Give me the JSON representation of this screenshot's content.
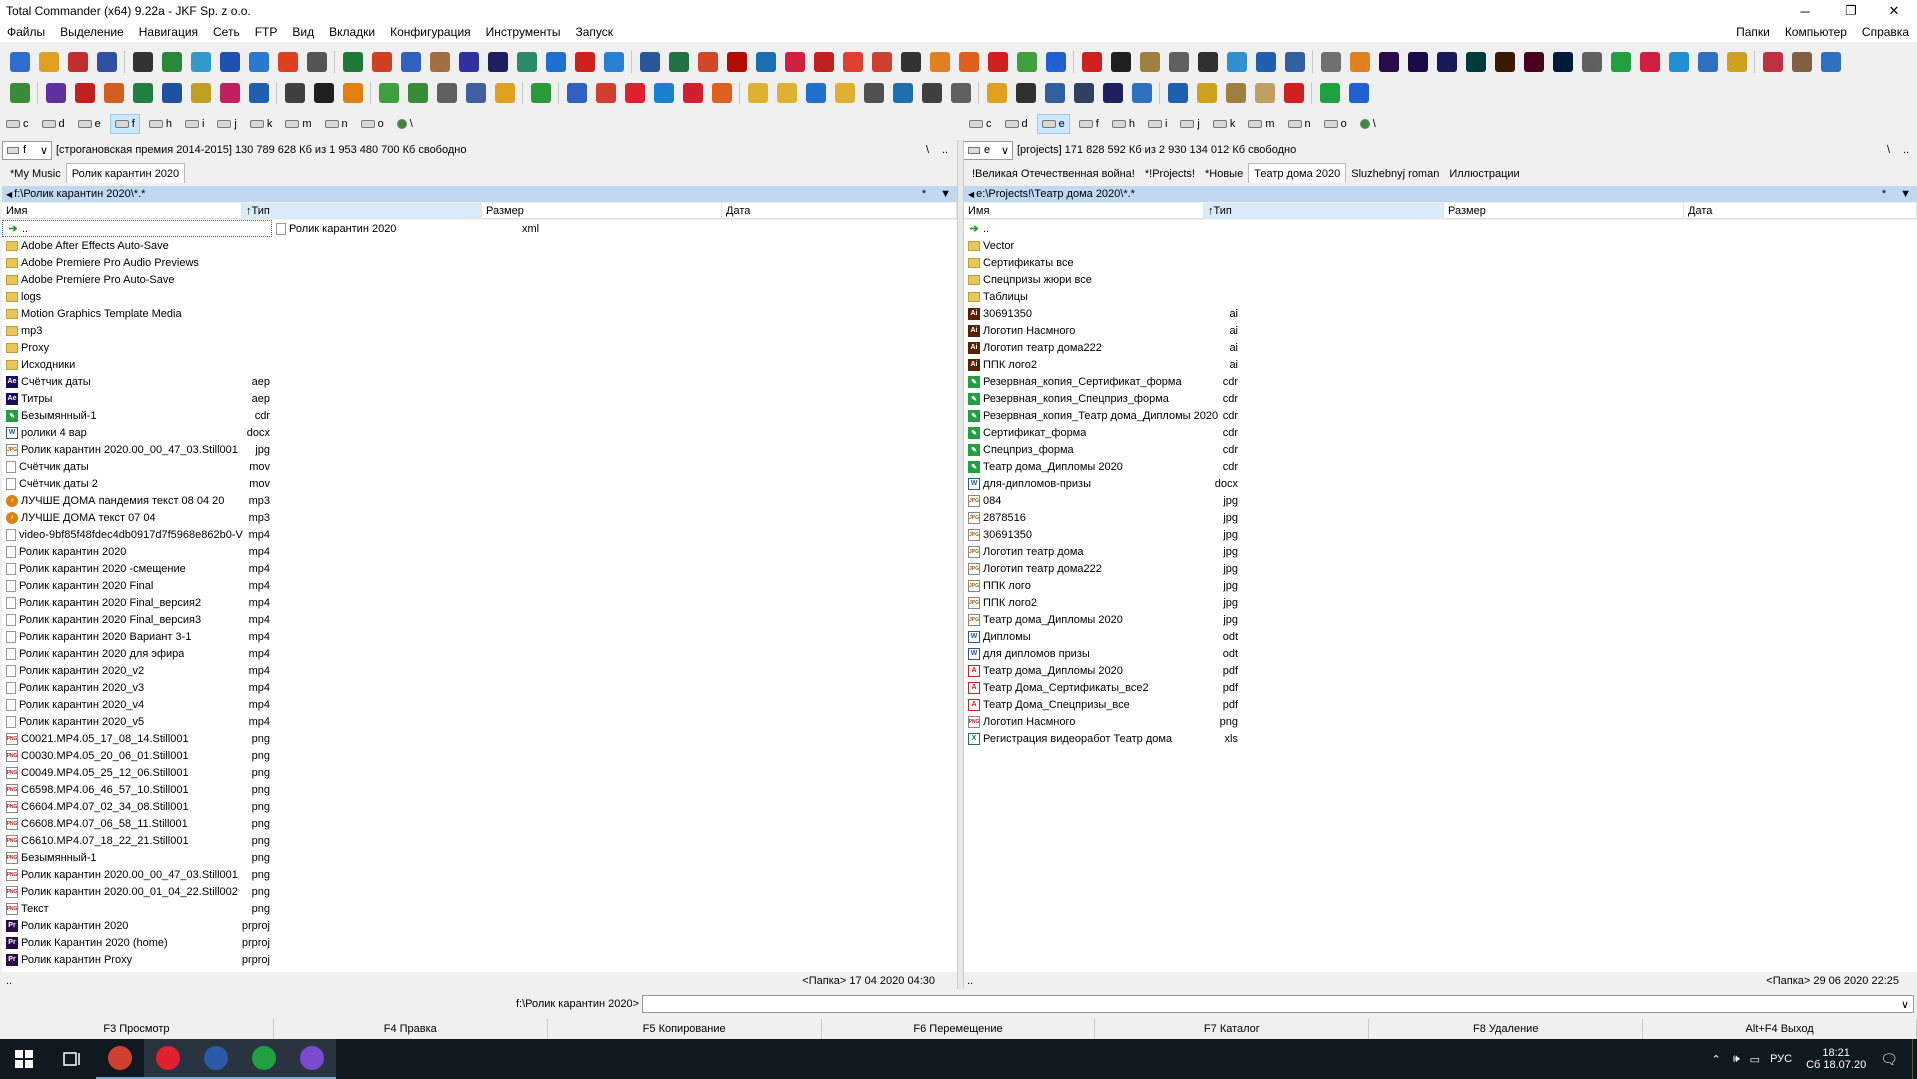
{
  "window": {
    "title": "Total Commander (x64) 9.22a - JKF Sp. z o.o."
  },
  "menu": {
    "left": [
      "Файлы",
      "Выделение",
      "Навигация",
      "Сеть",
      "FTP",
      "Вид",
      "Вкладки",
      "Конфигурация",
      "Инструменты",
      "Запуск"
    ],
    "right": [
      "Папки",
      "Компьютер",
      "Справка"
    ]
  },
  "toolbar_icons": {
    "row1": [
      {
        "name": "settings-gear-icon",
        "color": "#2d6fd1"
      },
      {
        "name": "settings-sun-icon",
        "color": "#e0a020"
      },
      {
        "name": "settings-cog-icon",
        "color": "#c03030"
      },
      {
        "name": "notepad-icon",
        "color": "#3050a0"
      },
      {
        "name": "cmd-icon",
        "color": "#333333"
      },
      {
        "name": "network-icon",
        "color": "#2a8a3a"
      },
      {
        "name": "ftp-icon",
        "color": "#3399cc"
      },
      {
        "name": "compare-icon",
        "color": "#2050b0"
      },
      {
        "name": "globe-icon",
        "color": "#2a7ad0"
      },
      {
        "name": "ccleaner-icon",
        "color": "#e04020"
      },
      {
        "name": "monitor-icon",
        "color": "#555555"
      },
      {
        "name": "excel-green-icon",
        "color": "#1f7a3a"
      },
      {
        "name": "sync-icon",
        "color": "#d04020"
      },
      {
        "name": "pin-icon",
        "color": "#3060c0"
      },
      {
        "name": "box-icon",
        "color": "#a07040"
      },
      {
        "name": "pcb-icon",
        "color": "#3030a0"
      },
      {
        "name": "tor-icon",
        "color": "#202060"
      },
      {
        "name": "spreadsheet-icon",
        "color": "#2a8a6a"
      },
      {
        "name": "chat-icon",
        "color": "#2070d0"
      },
      {
        "name": "video-icon",
        "color": "#d02020"
      },
      {
        "name": "clipboard-icon",
        "color": "#2a80d0"
      },
      {
        "name": "word-icon",
        "color": "#2b579a"
      },
      {
        "name": "excel-icon",
        "color": "#217346"
      },
      {
        "name": "powerpoint-icon",
        "color": "#d24726"
      },
      {
        "name": "acrobat-icon",
        "color": "#b30b00"
      },
      {
        "name": "photo-icon",
        "color": "#1a6fb0"
      },
      {
        "name": "share-icon",
        "color": "#d02040"
      },
      {
        "name": "vpn-icon",
        "color": "#c02020"
      },
      {
        "name": "scribus-icon",
        "color": "#e04030"
      },
      {
        "name": "chrome-icon",
        "color": "#d04030"
      },
      {
        "name": "inkscape-icon",
        "color": "#333333"
      },
      {
        "name": "paint-icon",
        "color": "#e08020"
      },
      {
        "name": "firefox-icon",
        "color": "#e06020"
      },
      {
        "name": "close-x-icon",
        "color": "#d02020"
      },
      {
        "name": "green-o-icon",
        "color": "#40a040"
      },
      {
        "name": "check-icon",
        "color": "#2060d0"
      },
      {
        "name": "youtube-icon",
        "color": "#d02020"
      },
      {
        "name": "dft-icon",
        "color": "#202020"
      },
      {
        "name": "disk-icon",
        "color": "#a08040"
      },
      {
        "name": "calculator-icon",
        "color": "#606060"
      },
      {
        "name": "circle-dark-icon",
        "color": "#303030"
      },
      {
        "name": "earth-icon",
        "color": "#3090d0"
      },
      {
        "name": "shield-blue-icon",
        "color": "#2060b0"
      },
      {
        "name": "chart-icon",
        "color": "#3060a0"
      },
      {
        "name": "gear-grey-icon",
        "color": "#707070"
      },
      {
        "name": "blender-icon",
        "color": "#e08020"
      },
      {
        "name": "premiere-icon",
        "color": "#2a0a4a"
      },
      {
        "name": "after-effects-icon",
        "color": "#1a0a4a"
      },
      {
        "name": "ae-icon",
        "color": "#1a1a5a"
      },
      {
        "name": "audition-icon",
        "color": "#003a3a"
      },
      {
        "name": "illustrator-icon",
        "color": "#3a1a00"
      },
      {
        "name": "indesign-icon",
        "color": "#4a0020"
      },
      {
        "name": "photoshop-icon",
        "color": "#001a3a"
      },
      {
        "name": "vm-icon",
        "color": "#606060"
      },
      {
        "name": "corel-icon",
        "color": "#20a040"
      },
      {
        "name": "opera-icon",
        "color": "#d02040"
      },
      {
        "name": "skype-icon",
        "color": "#2090d0"
      },
      {
        "name": "folder-tools-icon",
        "color": "#3070c0"
      },
      {
        "name": "photos-icon",
        "color": "#d0a020"
      },
      {
        "name": "pen-icon",
        "color": "#c03040"
      },
      {
        "name": "stamp-icon",
        "color": "#806040"
      },
      {
        "name": "cube-icon",
        "color": "#3070c0"
      }
    ],
    "row2": [
      {
        "name": "map-icon",
        "color": "#3a8a3a"
      },
      {
        "name": "shield-purple-icon",
        "color": "#6030a0"
      },
      {
        "name": "shield-red-icon",
        "color": "#c02020"
      },
      {
        "name": "shield-orange-icon",
        "color": "#d06020"
      },
      {
        "name": "shield-green-icon",
        "color": "#208040"
      },
      {
        "name": "shield-blue-s-icon",
        "color": "#2050a0"
      },
      {
        "name": "shield-yellow-icon",
        "color": "#c0a020"
      },
      {
        "name": "shield-pink-icon",
        "color": "#c02060"
      },
      {
        "name": "fe-icon",
        "color": "#2060b0"
      },
      {
        "name": "film-icon",
        "color": "#404040"
      },
      {
        "name": "vinyl-icon",
        "color": "#202020"
      },
      {
        "name": "vlc-icon",
        "color": "#e08010"
      },
      {
        "name": "notes-green-icon",
        "color": "#40a040"
      },
      {
        "name": "list-icon",
        "color": "#3a8a3a"
      },
      {
        "name": "editor-icon",
        "color": "#606060"
      },
      {
        "name": "preview-icon",
        "color": "#4060a0"
      },
      {
        "name": "winamp-icon",
        "color": "#e0a020"
      },
      {
        "name": "evernote-icon",
        "color": "#2a9a3a"
      },
      {
        "name": "mail-icon",
        "color": "#3060c0"
      },
      {
        "name": "chrome-2-icon",
        "color": "#d04030"
      },
      {
        "name": "vivaldi-icon",
        "color": "#e02030"
      },
      {
        "name": "ie-icon",
        "color": "#1a80d0"
      },
      {
        "name": "opera-2-icon",
        "color": "#d02030"
      },
      {
        "name": "firefox-2-icon",
        "color": "#e06020"
      },
      {
        "name": "folder-1-icon",
        "color": "#e0b030"
      },
      {
        "name": "folder-2-icon",
        "color": "#e0b030"
      },
      {
        "name": "onedrive-icon",
        "color": "#2070d0"
      },
      {
        "name": "folder-3-icon",
        "color": "#e0b030"
      },
      {
        "name": "drive-icon",
        "color": "#505050"
      },
      {
        "name": "globe-2-icon",
        "color": "#2070b0"
      },
      {
        "name": "refresh-icon",
        "color": "#404040"
      },
      {
        "name": "link-icon",
        "color": "#606060"
      },
      {
        "name": "checkbox-icon",
        "color": "#e0a020"
      },
      {
        "name": "filmstrip-icon",
        "color": "#303030"
      },
      {
        "name": "calendar-icon",
        "color": "#3060a0"
      },
      {
        "name": "archive-icon",
        "color": "#304060"
      },
      {
        "name": "shield-dark-icon",
        "color": "#202060"
      },
      {
        "name": "badge-icon",
        "color": "#3070c0"
      },
      {
        "name": "wf-icon",
        "color": "#2060b0"
      },
      {
        "name": "coin-icon",
        "color": "#d0a020"
      },
      {
        "name": "frame-icon",
        "color": "#a08040"
      },
      {
        "name": "package-icon",
        "color": "#c0a060"
      },
      {
        "name": "magnet-icon",
        "color": "#d02020"
      },
      {
        "name": "plus-icon",
        "color": "#20a040"
      },
      {
        "name": "info-icon",
        "color": "#2060d0"
      }
    ]
  },
  "left_panel": {
    "drives": [
      "c",
      "d",
      "e",
      "f",
      "h",
      "i",
      "j",
      "k",
      "m",
      "n",
      "o",
      "\\"
    ],
    "active_drive": "f",
    "drive_select": "f",
    "volume_info": "[строгановская премия 2014-2015]  130 789 628 Кб из 1 953 480 700 Кб свободно",
    "nav_root": "\\",
    "nav_up": "..",
    "tabs": [
      "*My Music",
      "Ролик карантин 2020"
    ],
    "active_tab": 1,
    "path": "f:\\Ролик карантин 2020\\*.*",
    "path_star": "*",
    "path_arrow": "▼",
    "columns": {
      "name": "Имя",
      "type": "↑Тип",
      "size": "Размер",
      "date": "Дата"
    },
    "files": [
      {
        "name": "..",
        "ext": "",
        "icon": "up"
      },
      {
        "name": "Adobe After Effects Auto-Save",
        "ext": "",
        "icon": "folder"
      },
      {
        "name": "Adobe Premiere Pro Audio Previews",
        "ext": "",
        "icon": "folder"
      },
      {
        "name": "Adobe Premiere Pro Auto-Save",
        "ext": "",
        "icon": "folder"
      },
      {
        "name": "logs",
        "ext": "",
        "icon": "folder"
      },
      {
        "name": "Motion Graphics Template Media",
        "ext": "",
        "icon": "folder"
      },
      {
        "name": "mp3",
        "ext": "",
        "icon": "folder"
      },
      {
        "name": "Proxy",
        "ext": "",
        "icon": "folder"
      },
      {
        "name": "Исходники",
        "ext": "",
        "icon": "folder"
      },
      {
        "name": "Счётчик даты",
        "ext": "aep",
        "icon": "aep"
      },
      {
        "name": "Титры",
        "ext": "aep",
        "icon": "aep"
      },
      {
        "name": "Безымянный-1",
        "ext": "cdr",
        "icon": "cdr"
      },
      {
        "name": "ролики 4 вар",
        "ext": "docx",
        "icon": "docx"
      },
      {
        "name": "Ролик карантин 2020.00_00_47_03.Still001",
        "ext": "jpg",
        "icon": "jpg"
      },
      {
        "name": "Счётчик даты",
        "ext": "mov",
        "icon": "doc"
      },
      {
        "name": "Счётчик даты 2",
        "ext": "mov",
        "icon": "doc"
      },
      {
        "name": "ЛУЧШЕ ДОМА пандемия текст 08 04 20",
        "ext": "mp3",
        "icon": "mp3"
      },
      {
        "name": "ЛУЧШЕ ДОМА текст 07 04",
        "ext": "mp3",
        "icon": "mp3"
      },
      {
        "name": "video-9bf85f48fdec4db0917d7f5968e862b0-V",
        "ext": "mp4",
        "icon": "doc"
      },
      {
        "name": "Ролик карантин 2020",
        "ext": "mp4",
        "icon": "doc"
      },
      {
        "name": "Ролик карантин 2020 -смещение",
        "ext": "mp4",
        "icon": "doc"
      },
      {
        "name": "Ролик карантин 2020 Final",
        "ext": "mp4",
        "icon": "doc"
      },
      {
        "name": "Ролик карантин 2020 Final_версия2",
        "ext": "mp4",
        "icon": "doc"
      },
      {
        "name": "Ролик карантин 2020 Final_версия3",
        "ext": "mp4",
        "icon": "doc"
      },
      {
        "name": "Ролик карантин 2020 Вариант 3-1",
        "ext": "mp4",
        "icon": "doc"
      },
      {
        "name": "Ролик карантин 2020 для эфира",
        "ext": "mp4",
        "icon": "doc"
      },
      {
        "name": "Ролик карантин 2020_v2",
        "ext": "mp4",
        "icon": "doc"
      },
      {
        "name": "Ролик карантин 2020_v3",
        "ext": "mp4",
        "icon": "doc"
      },
      {
        "name": "Ролик карантин 2020_v4",
        "ext": "mp4",
        "icon": "doc"
      },
      {
        "name": "Ролик карантин 2020_v5",
        "ext": "mp4",
        "icon": "doc"
      },
      {
        "name": "C0021.MP4.05_17_08_14.Still001",
        "ext": "png",
        "icon": "png"
      },
      {
        "name": "C0030.MP4.05_20_06_01.Still001",
        "ext": "png",
        "icon": "png"
      },
      {
        "name": "C0049.MP4.05_25_12_06.Still001",
        "ext": "png",
        "icon": "png"
      },
      {
        "name": "C6598.MP4.06_46_57_10.Still001",
        "ext": "png",
        "icon": "png"
      },
      {
        "name": "C6604.MP4.07_02_34_08.Still001",
        "ext": "png",
        "icon": "png"
      },
      {
        "name": "C6608.MP4.07_06_58_11.Still001",
        "ext": "png",
        "icon": "png"
      },
      {
        "name": "C6610.MP4.07_18_22_21.Still001",
        "ext": "png",
        "icon": "png"
      },
      {
        "name": "Безымянный-1",
        "ext": "png",
        "icon": "png"
      },
      {
        "name": "Ролик карантин 2020.00_00_47_03.Still001",
        "ext": "png",
        "icon": "png"
      },
      {
        "name": "Ролик карантин 2020.00_01_04_22.Still002",
        "ext": "png",
        "icon": "png"
      },
      {
        "name": "Текст",
        "ext": "png",
        "icon": "png"
      },
      {
        "name": "Ролик карантин 2020",
        "ext": "prproj",
        "icon": "prproj"
      },
      {
        "name": "Ролик Карантин 2020 (home)",
        "ext": "prproj",
        "icon": "prproj"
      },
      {
        "name": "Ролик карантин Proxy",
        "ext": "prproj",
        "icon": "prproj"
      }
    ],
    "second_col_file": {
      "name": "Ролик карантин 2020",
      "ext": "xml"
    },
    "status_left": "..",
    "status_right": "<Папка> 17 04 2020 04:30"
  },
  "right_panel": {
    "drives": [
      "c",
      "d",
      "e",
      "f",
      "h",
      "i",
      "j",
      "k",
      "m",
      "n",
      "o",
      "\\"
    ],
    "active_drive": "e",
    "drive_select": "e",
    "volume_info": "[projects]  171 828 592 Кб из 2 930 134 012 Кб свободно",
    "nav_root": "\\",
    "nav_up": "..",
    "tabs": [
      "!Великая Отечественная война!",
      "*!Projects!",
      "*Новые",
      "Театр дома 2020",
      "Sluzhebnyj roman",
      "Иллюстрации"
    ],
    "active_tab": 3,
    "path": "e:\\Projects!\\Театр дома 2020\\*.*",
    "path_star": "*",
    "path_arrow": "▼",
    "columns": {
      "name": "Имя",
      "type": "↑Тип",
      "size": "Размер",
      "date": "Дата"
    },
    "files": [
      {
        "name": "..",
        "ext": "",
        "icon": "up"
      },
      {
        "name": "Vector",
        "ext": "",
        "icon": "folder"
      },
      {
        "name": "Сертификаты все",
        "ext": "",
        "icon": "folder"
      },
      {
        "name": "Спецпризы жюри все",
        "ext": "",
        "icon": "folder"
      },
      {
        "name": "Таблицы",
        "ext": "",
        "icon": "folder"
      },
      {
        "name": "30691350",
        "ext": "ai",
        "icon": "ai"
      },
      {
        "name": "Логотип Насмного",
        "ext": "ai",
        "icon": "ai"
      },
      {
        "name": "Логотип театр дома222",
        "ext": "ai",
        "icon": "ai"
      },
      {
        "name": "ППК лого2",
        "ext": "ai",
        "icon": "ai"
      },
      {
        "name": "Резервная_копия_Сертификат_форма",
        "ext": "cdr",
        "icon": "cdr"
      },
      {
        "name": "Резервная_копия_Спецприз_форма",
        "ext": "cdr",
        "icon": "cdr"
      },
      {
        "name": "Резервная_копия_Театр дома_Дипломы 2020",
        "ext": "cdr",
        "icon": "cdr"
      },
      {
        "name": "Сертификат_форма",
        "ext": "cdr",
        "icon": "cdr"
      },
      {
        "name": "Спецприз_форма",
        "ext": "cdr",
        "icon": "cdr"
      },
      {
        "name": "Театр дома_Дипломы 2020",
        "ext": "cdr",
        "icon": "cdr"
      },
      {
        "name": "для-дипломов-призы",
        "ext": "docx",
        "icon": "docx"
      },
      {
        "name": "084",
        "ext": "jpg",
        "icon": "jpg"
      },
      {
        "name": "2878516",
        "ext": "jpg",
        "icon": "jpg"
      },
      {
        "name": "30691350",
        "ext": "jpg",
        "icon": "jpg"
      },
      {
        "name": "Логотип театр дома",
        "ext": "jpg",
        "icon": "jpg"
      },
      {
        "name": "Логотип театр дома222",
        "ext": "jpg",
        "icon": "jpg"
      },
      {
        "name": "ППК лого",
        "ext": "jpg",
        "icon": "jpg"
      },
      {
        "name": "ППК лого2",
        "ext": "jpg",
        "icon": "jpg"
      },
      {
        "name": "Театр дома_Дипломы 2020",
        "ext": "jpg",
        "icon": "jpg"
      },
      {
        "name": "Дипломы",
        "ext": "odt",
        "icon": "docx"
      },
      {
        "name": "для дипломов призы",
        "ext": "odt",
        "icon": "docx"
      },
      {
        "name": "Театр дома_Дипломы 2020",
        "ext": "pdf",
        "icon": "pdf"
      },
      {
        "name": "Театр Дома_Сертификаты_все2",
        "ext": "pdf",
        "icon": "pdf"
      },
      {
        "name": "Театр Дома_Спецпризы_все",
        "ext": "pdf",
        "icon": "pdf"
      },
      {
        "name": "Логотип Насмного",
        "ext": "png",
        "icon": "png"
      },
      {
        "name": "Регистрация видеоработ Театр дома",
        "ext": "xls",
        "icon": "xls"
      }
    ],
    "status_left": "..",
    "status_right": "<Папка> 29 06 2020 22:25"
  },
  "cmdline": {
    "prompt": "f:\\Ролик карантин 2020>",
    "value": "",
    "arrow": "∨"
  },
  "fkeys": [
    "F3 Просмотр",
    "F4 Правка",
    "F5 Копирование",
    "F6 Перемещение",
    "F7 Каталог",
    "F8 Удаление",
    "Alt+F4 Выход"
  ],
  "taskbar": {
    "apps": [
      {
        "name": "chrome-taskbar-icon",
        "color": "#d04030"
      },
      {
        "name": "vivaldi-taskbar-icon",
        "color": "#e02030"
      },
      {
        "name": "total-commander-taskbar-icon",
        "color": "#2a5aa8"
      },
      {
        "name": "corel-taskbar-icon",
        "color": "#20a040"
      },
      {
        "name": "viber-taskbar-icon",
        "color": "#7a4ad0"
      }
    ],
    "lang": "РУС",
    "time": "18:21",
    "date": "Сб 18.07.20"
  }
}
